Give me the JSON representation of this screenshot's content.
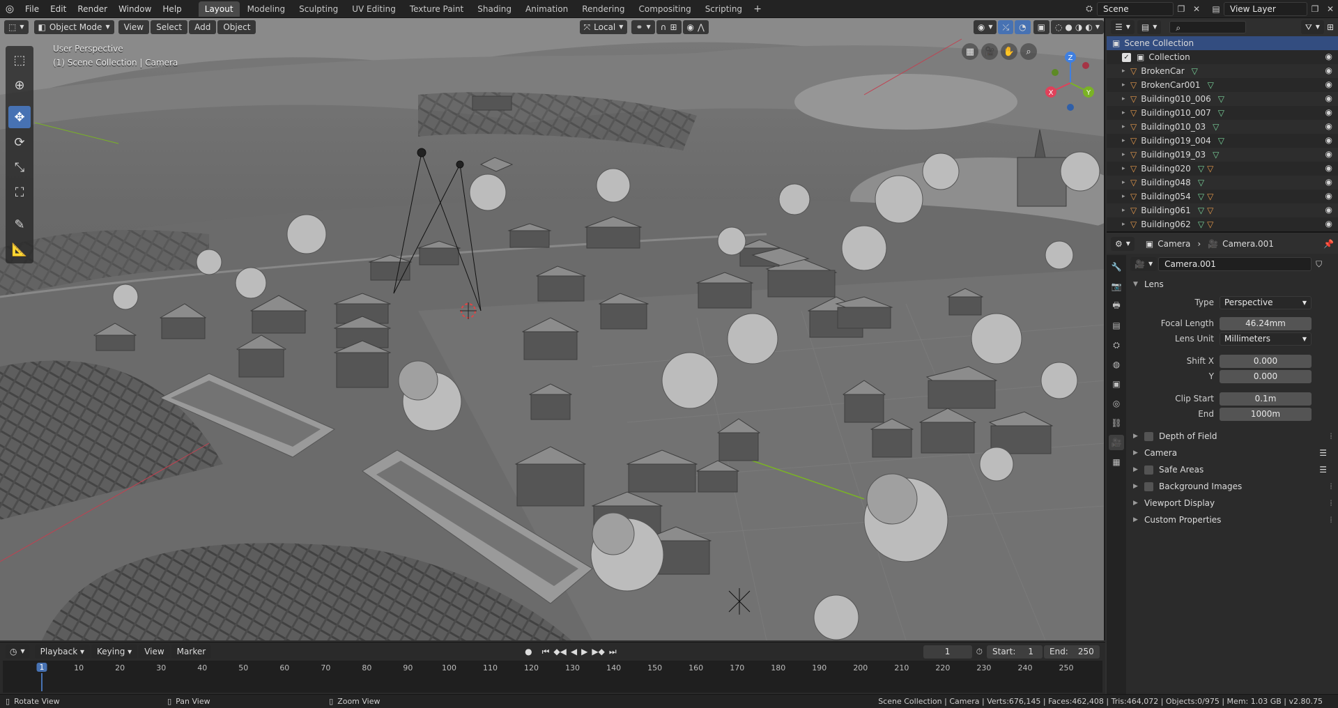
{
  "topbar": {
    "menus": [
      "File",
      "Edit",
      "Render",
      "Window",
      "Help"
    ],
    "workspaces": [
      "Layout",
      "Modeling",
      "Sculpting",
      "UV Editing",
      "Texture Paint",
      "Shading",
      "Animation",
      "Rendering",
      "Compositing",
      "Scripting"
    ],
    "active_workspace": "Layout",
    "add_workspace": "+",
    "scene_name": "Scene",
    "view_layer": "View Layer"
  },
  "viewport": {
    "mode": "Object Mode",
    "menus": [
      "View",
      "Select",
      "Add",
      "Object"
    ],
    "orientation": "Local",
    "perspective_label": "User Perspective",
    "context_label": "(1) Scene Collection | Camera",
    "gizmo_axes": {
      "x": "X",
      "y": "Y",
      "z": "Z"
    }
  },
  "timeline": {
    "menus": [
      "Playback",
      "Keying",
      "View",
      "Marker"
    ],
    "current_frame": "1",
    "start_label": "Start:",
    "start": "1",
    "end_label": "End:",
    "end": "250",
    "ruler_ticks": [
      "1",
      "10",
      "20",
      "30",
      "40",
      "50",
      "60",
      "70",
      "80",
      "90",
      "100",
      "110",
      "120",
      "130",
      "140",
      "150",
      "160",
      "170",
      "180",
      "190",
      "200",
      "210",
      "220",
      "230",
      "240",
      "250"
    ]
  },
  "statusbar": {
    "rotate": "Rotate View",
    "pan": "Pan View",
    "zoom": "Zoom View",
    "stats": "Scene Collection | Camera | Verts:676,145 | Faces:462,408 | Tris:464,072 | Objects:0/975 | Mem: 1.03 GB | v2.80.75"
  },
  "outliner": {
    "root": "Scene Collection",
    "collection": "Collection",
    "items": [
      {
        "name": "BrokenCar",
        "extra": false
      },
      {
        "name": "BrokenCar001",
        "extra": false
      },
      {
        "name": "Building010_006",
        "extra": false
      },
      {
        "name": "Building010_007",
        "extra": false
      },
      {
        "name": "Building010_03",
        "extra": false
      },
      {
        "name": "Building019_004",
        "extra": false
      },
      {
        "name": "Building019_03",
        "extra": false
      },
      {
        "name": "Building020",
        "extra": true
      },
      {
        "name": "Building048",
        "extra": false
      },
      {
        "name": "Building054",
        "extra": true
      },
      {
        "name": "Building061",
        "extra": true
      },
      {
        "name": "Building062",
        "extra": true
      }
    ]
  },
  "properties": {
    "breadcrumb_object": "Camera",
    "breadcrumb_data": "Camera.001",
    "datablock": "Camera.001",
    "lens_panel": "Lens",
    "type_label": "Type",
    "type_value": "Perspective",
    "focal_label": "Focal Length",
    "focal_value": "46.24mm",
    "lens_unit_label": "Lens Unit",
    "lens_unit_value": "Millimeters",
    "shiftx_label": "Shift X",
    "shiftx_value": "0.000",
    "shifty_label": "Y",
    "shifty_value": "0.000",
    "clip_start_label": "Clip Start",
    "clip_start_value": "0.1m",
    "clip_end_label": "End",
    "clip_end_value": "1000m",
    "panels": [
      {
        "label": "Depth of Field",
        "checkbox": true,
        "list": false
      },
      {
        "label": "Camera",
        "checkbox": false,
        "list": true
      },
      {
        "label": "Safe Areas",
        "checkbox": true,
        "list": true
      },
      {
        "label": "Background Images",
        "checkbox": true,
        "list": false
      },
      {
        "label": "Viewport Display",
        "checkbox": false,
        "list": false
      },
      {
        "label": "Custom Properties",
        "checkbox": false,
        "list": false
      }
    ]
  },
  "colors": {
    "accent": "#4772b3",
    "x_axis": "#e0415a",
    "y_axis": "#7ab325",
    "z_axis": "#3f7fe0"
  }
}
